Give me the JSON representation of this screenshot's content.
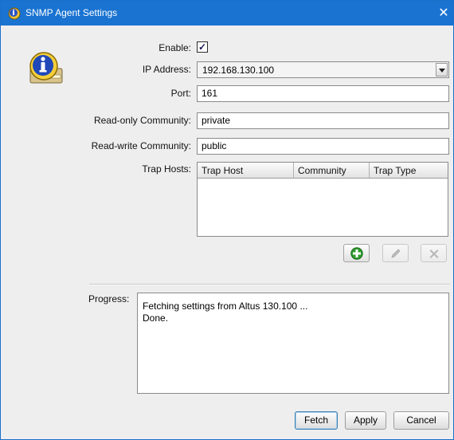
{
  "window": {
    "title": "SNMP Agent Settings",
    "close_glyph": "✕",
    "app_icon": "snmp-app-icon"
  },
  "form": {
    "enable_label": "Enable:",
    "enable_checked": true,
    "enable_glyph": "✓",
    "ip_label": "IP Address:",
    "ip_value": "192.168.130.100",
    "port_label": "Port:",
    "port_value": "161",
    "ro_label": "Read-only Community:",
    "ro_value": "private",
    "rw_label": "Read-write Community:",
    "rw_value": "public",
    "trap_label": "Trap Hosts:"
  },
  "trap_table": {
    "columns": [
      "Trap Host",
      "Community",
      "Trap Type"
    ],
    "rows": []
  },
  "trap_actions": {
    "add_icon": "plus-icon",
    "edit_icon": "pencil-icon",
    "delete_icon": "x-icon"
  },
  "progress": {
    "label": "Progress:",
    "lines": [
      "Fetching settings from Altus 130.100 ...",
      "Done."
    ]
  },
  "buttons": {
    "fetch": "Fetch",
    "apply": "Apply",
    "cancel": "Cancel"
  },
  "colors": {
    "titlebar": "#1a73d1",
    "add_icon_green": "#2e9b2e"
  }
}
